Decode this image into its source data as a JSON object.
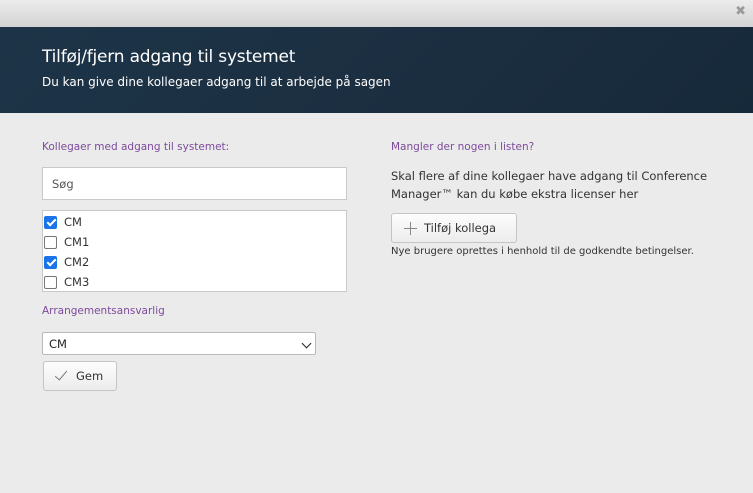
{
  "dialog": {
    "close_label": "✖",
    "title": "Tilføj/fjern adgang til systemet",
    "subtitle": "Du kan give dine kollegaer adgang til at arbejde på sagen"
  },
  "left": {
    "access_label": "Kollegaer med adgang til systemet:",
    "search_placeholder": "Søg",
    "colleagues": [
      {
        "name": "CM",
        "checked": true
      },
      {
        "name": "CM1",
        "checked": false
      },
      {
        "name": "CM2",
        "checked": true
      },
      {
        "name": "CM3",
        "checked": false
      }
    ],
    "organizer_label": "Arrangementsansvarlig",
    "organizer_selected": "CM",
    "save_label": "Gem"
  },
  "right": {
    "missing_label": "Mangler der nogen i listen?",
    "description": "Skal flere af dine kollegaer have adgang til Conference Manager™ kan du købe ekstra licenser her",
    "add_label": "Tilføj kollega",
    "note": "Nye brugere oprettes i henhold til de godkendte betingelser."
  },
  "colors": {
    "header_bg": "#1b2e40",
    "label_purple": "#7d4a9b",
    "checkbox_blue": "#1a73e8",
    "page_bg": "#ebebeb"
  }
}
